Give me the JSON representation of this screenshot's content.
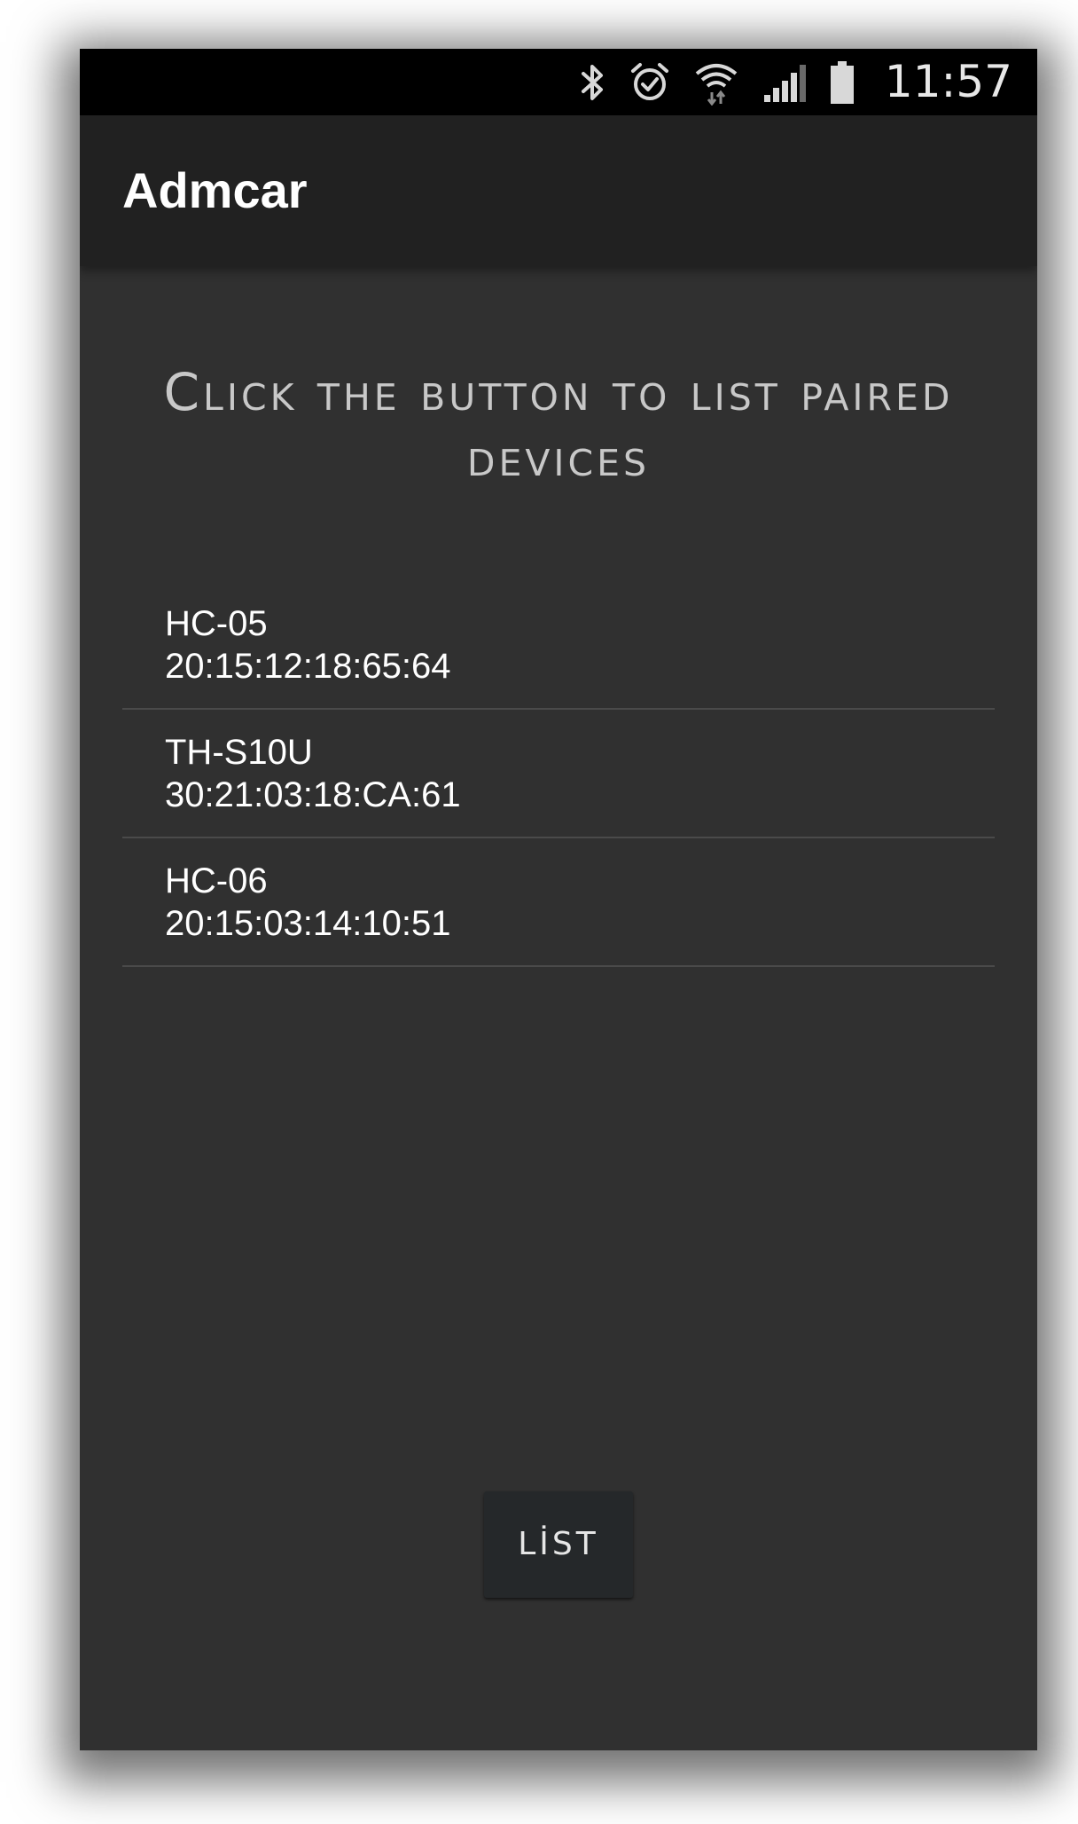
{
  "status_bar": {
    "time": "11:57",
    "icons": [
      "bluetooth-icon",
      "alarm-icon",
      "wifi-icon",
      "signal-icon",
      "battery-icon"
    ]
  },
  "app_bar": {
    "title": "Admcar"
  },
  "main": {
    "instruction": "Click the button to list paired devices",
    "devices": [
      {
        "name": "HC-05",
        "address": "20:15:12:18:65:64"
      },
      {
        "name": "TH-S10U",
        "address": "30:21:03:18:CA:61"
      },
      {
        "name": "HC-06",
        "address": "20:15:03:14:10:51"
      }
    ],
    "list_button_label": "LİST"
  },
  "colors": {
    "background": "#303030",
    "app_bar": "#212121",
    "status_bar": "#000000",
    "text": "#ffffff"
  }
}
